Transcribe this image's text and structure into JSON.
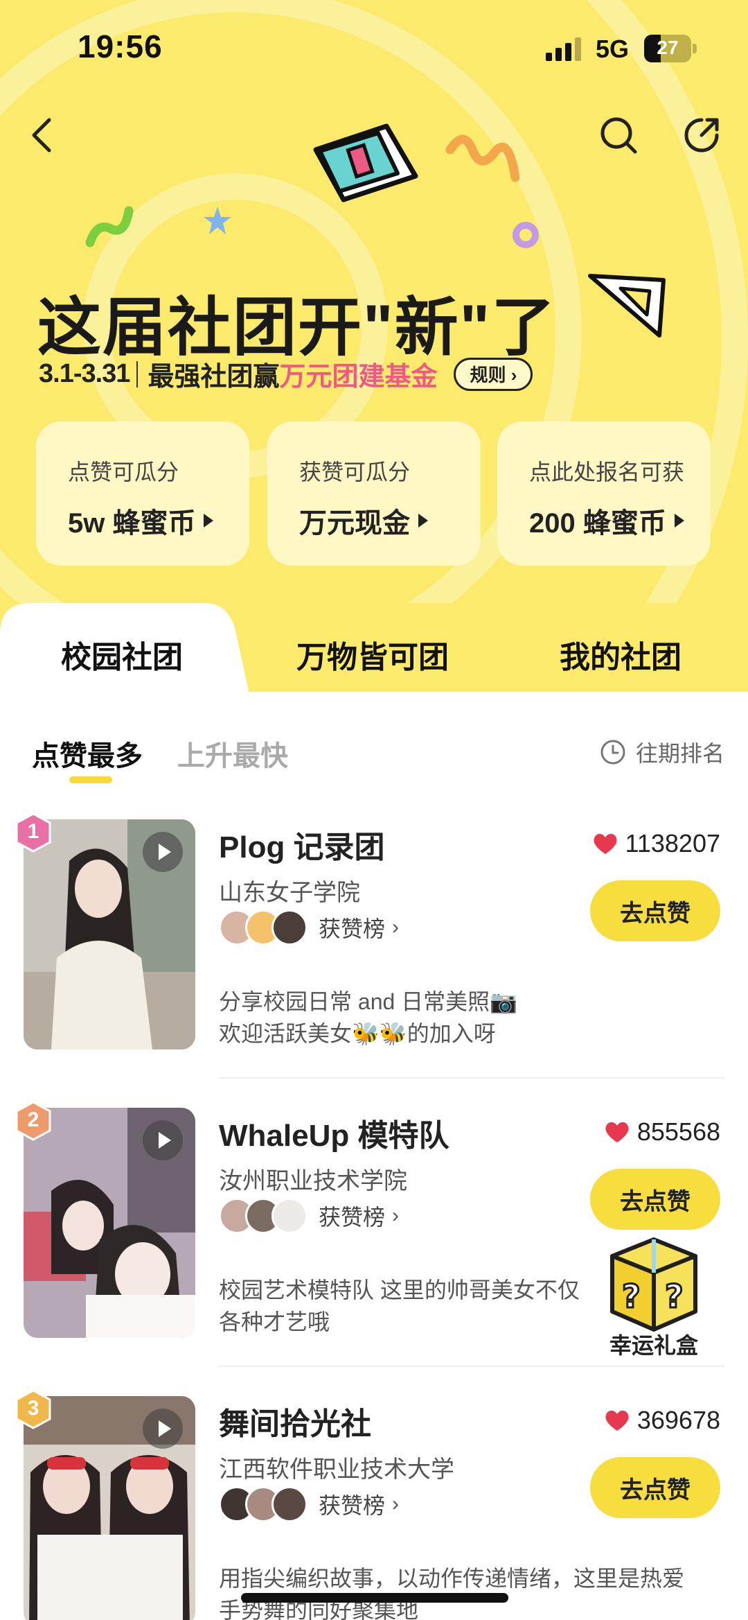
{
  "status": {
    "time": "19:56",
    "network": "5G",
    "battery": "27"
  },
  "colors": {
    "hero_bg": "#fbea6c",
    "accent_pink": "#ee5a86",
    "button_yellow": "#f8dd3e",
    "heart_red": "#e8384f"
  },
  "hero": {
    "headline": "这届社团开\"新\"了",
    "date_range": "3.1-3.31",
    "tagline_prefix": "最强社团赢",
    "tagline_accent": "万元团建基金",
    "rules_label": "规则 ›"
  },
  "rewards": [
    {
      "title": "点赞可瓜分",
      "value": "5w 蜂蜜币"
    },
    {
      "title": "获赞可瓜分",
      "value": "万元现金"
    },
    {
      "title": "点此处报名可获",
      "value": "200 蜂蜜币"
    }
  ],
  "tabs": [
    "校园社团",
    "万物皆可团",
    "我的社团"
  ],
  "subtabs": {
    "active": "点赞最多",
    "inactive": "上升最快",
    "history": "往期排名"
  },
  "items": [
    {
      "rank": "1",
      "name": "Plog 记录团",
      "school": "山东女子学院",
      "likes": "1138207",
      "praise": "获赞榜",
      "button": "去点赞",
      "desc1": "分享校园日常 and 日常美照📷",
      "desc2": "欢迎活跃美女🐝🐝的加入呀"
    },
    {
      "rank": "2",
      "name": "WhaleUp 模特队",
      "school": "汝州职业技术学院",
      "likes": "855568",
      "praise": "获赞榜",
      "button": "去点赞",
      "desc1": "校园艺术模特队 这里的帅哥美女不仅",
      "desc2": "各种才艺哦"
    },
    {
      "rank": "3",
      "name": "舞间拾光社",
      "school": "江西软件职业技术大学",
      "likes": "369678",
      "praise": "获赞榜",
      "button": "去点赞",
      "desc1": "用指尖编织故事，以动作传递情绪，这里是热爱",
      "desc2": "手势舞的同好聚集地"
    }
  ],
  "gift": {
    "label": "幸运礼盒"
  },
  "icons": [
    "back-icon",
    "search-icon",
    "share-icon",
    "play-icon",
    "heart-icon",
    "clock-icon",
    "gift-box-icon"
  ]
}
